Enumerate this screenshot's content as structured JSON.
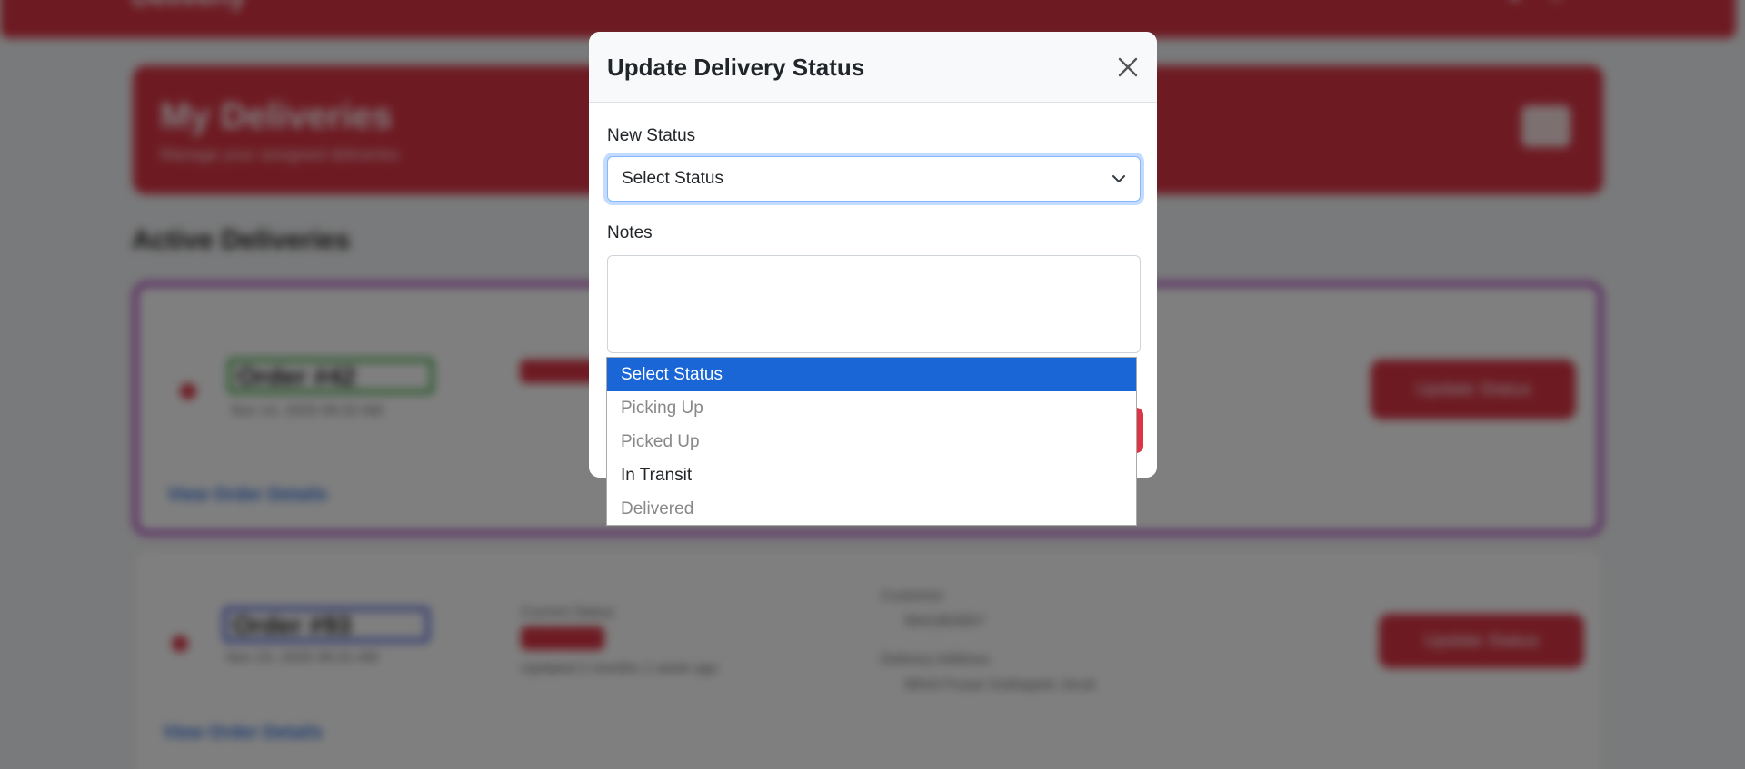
{
  "background": {
    "brand": "Deliverly",
    "hero": {
      "title": "My Deliveries",
      "subtitle": "Manage your assigned deliveries"
    },
    "section_title": "Active Deliveries",
    "cards": [
      {
        "order": "Order #42",
        "date": "Nov 14, 2025 09:32 AM",
        "update_button": "Update Status",
        "link": "View Order Details"
      },
      {
        "order": "Order #93",
        "date": "Nov 23, 2025 09:31 AM",
        "status_label": "Current Status",
        "updated": "Updated 2 months 1 week ago",
        "customer_label": "Customer",
        "customer": "9941863657",
        "address_label": "Delivery Address",
        "address": "Mhirit Pusan Gothapelo Jeruk",
        "update_button": "Update Status",
        "link": "View Order Details"
      }
    ]
  },
  "modal": {
    "title": "Update Delivery Status",
    "status_label": "New Status",
    "status_value": "Select Status",
    "notes_label": "Notes",
    "notes_value": ""
  },
  "dropdown": {
    "options": [
      {
        "label": "Select Status",
        "state": "selected"
      },
      {
        "label": "Picking Up",
        "state": "disabled"
      },
      {
        "label": "Picked Up",
        "state": "disabled"
      },
      {
        "label": "In Transit",
        "state": "enabled"
      },
      {
        "label": "Delivered",
        "state": "disabled"
      }
    ]
  },
  "colors": {
    "accent": "#dc3545",
    "focus": "#86b7fe",
    "selected_option": "#1a66d6"
  },
  "icons": [
    "close-icon",
    "chevron-down-icon"
  ]
}
